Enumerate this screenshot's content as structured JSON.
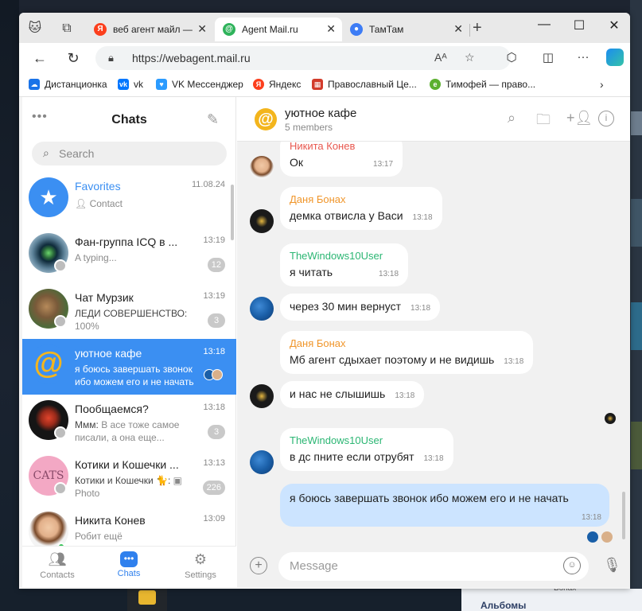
{
  "browser": {
    "tabs": [
      {
        "title": "веб агент майл — ",
        "icon": "yandex-icon",
        "color": "#fc3f1d",
        "letter": "Я"
      },
      {
        "title": "Agent Mail.ru",
        "icon": "agent-mail-icon",
        "color": "#2fb35b",
        "letter": "@"
      },
      {
        "title": "ТамТам",
        "icon": "tamtam-icon",
        "color": "#3d7cf5",
        "letter": "●"
      }
    ],
    "url": "https://webagent.mail.ru",
    "bookmarks": [
      {
        "label": "Дистанционка",
        "icon": "cloud-icon",
        "color": "#1a73e8"
      },
      {
        "label": "vk",
        "icon": "vk-icon",
        "color": "#0077ff",
        "letter": "vk"
      },
      {
        "label": "VK Мессенджер",
        "icon": "vk-messenger-icon",
        "color": "#2b9bff",
        "letter": "♥"
      },
      {
        "label": "Яндекс",
        "icon": "yandex-icon",
        "color": "#fc3f1d",
        "letter": "Я"
      },
      {
        "label": "Православный Це...",
        "icon": "calendar-icon",
        "color": "#d23b2b",
        "letter": "▦"
      },
      {
        "label": "Тимофей — право...",
        "icon": "green-icon",
        "color": "#5cb030",
        "letter": "e"
      }
    ]
  },
  "sidebar": {
    "title": "Chats",
    "search_placeholder": "Search",
    "chats": [
      {
        "name": "Favorites",
        "time": "11.08.24",
        "preview": "Contact",
        "badge": ""
      },
      {
        "name": "Фан-группа ICQ в ...",
        "time": "13:19",
        "preview": "A typing...",
        "badge": "12"
      },
      {
        "name": "Чат Мурзик",
        "time": "13:19",
        "preview_sender": "ЛЕДИ СОВЕРШЕНСТВО:",
        "preview": "100%",
        "badge": "3"
      },
      {
        "name": "уютное кафе",
        "time": "13:18",
        "preview": "я боюсь завершать звонок ибо можем его и не начать",
        "badge": ""
      },
      {
        "name": "Пообщаемся?",
        "time": "13:18",
        "preview_sender": "Ммм:",
        "preview": "В асе тоже самое писали, а она еще...",
        "badge": "3"
      },
      {
        "name": "Котики и Кошечки ...",
        "time": "13:13",
        "preview_sender": "Котики и Кошечки 🐈:",
        "preview": "Photo",
        "badge": "226"
      },
      {
        "name": "Никита Конев",
        "time": "13:09",
        "preview": "Робит ещё",
        "badge": ""
      }
    ],
    "nav": [
      {
        "label": "Contacts"
      },
      {
        "label": "Chats"
      },
      {
        "label": "Settings"
      }
    ]
  },
  "chat": {
    "title": "уютное кафе",
    "members": "5 members",
    "messages": [
      {
        "sender": "Никита Конев",
        "sender_color": "#e8584f",
        "text": "Ок",
        "time": "13:17"
      },
      {
        "sender": "Даня Бонах",
        "sender_color": "#f0962b",
        "text": "демка отвисла у Васи",
        "time": "13:18"
      },
      {
        "sender": "TheWindows10User",
        "sender_color": "#2bb673",
        "text": "я читать",
        "time": "13:18"
      },
      {
        "sender": "",
        "text": "через 30 мин вернуст",
        "time": "13:18"
      },
      {
        "sender": "Даня Бонах",
        "sender_color": "#f0962b",
        "text": "Мб агент сдыхает поэтому и не видишь",
        "time": "13:18"
      },
      {
        "sender": "",
        "text": "и нас не слышишь",
        "time": "13:18"
      },
      {
        "sender": "TheWindows10User",
        "sender_color": "#2bb673",
        "text": "в дс пните если отрубят",
        "time": "13:18"
      },
      {
        "sender": "",
        "text": "я боюсь завершать звонок ибо можем его и не начать",
        "time": "13:18"
      }
    ],
    "composer_placeholder": "Message"
  },
  "background": {
    "behind_text": "Бонах",
    "behind_title": "Альбомы"
  },
  "colors": {
    "accent": "#3b8ff2",
    "my_bubble": "#cce4ff"
  }
}
